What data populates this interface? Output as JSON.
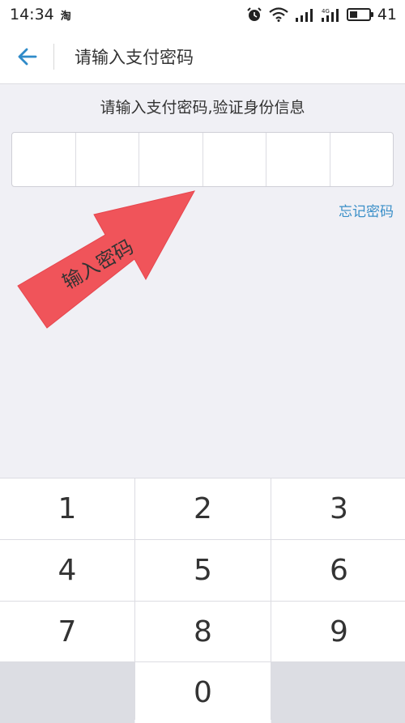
{
  "status_bar": {
    "time": "14:34",
    "app_icon": "淘",
    "network_label": "4G",
    "battery_level": "41",
    "battery_fraction": 0.41
  },
  "header": {
    "title": "请输入支付密码",
    "back_icon": "arrow-left-icon"
  },
  "main": {
    "instruction": "请输入支付密码,验证身份信息",
    "pin_length": 6,
    "forgot_link": "忘记密码"
  },
  "annotation": {
    "label": "输入密码",
    "color": "#f0545a"
  },
  "keypad": {
    "keys": [
      "1",
      "2",
      "3",
      "4",
      "5",
      "6",
      "7",
      "8",
      "9",
      "0"
    ]
  },
  "colors": {
    "accent": "#3a8fc8",
    "background": "#f0f0f5",
    "arrow": "#f0545a"
  }
}
